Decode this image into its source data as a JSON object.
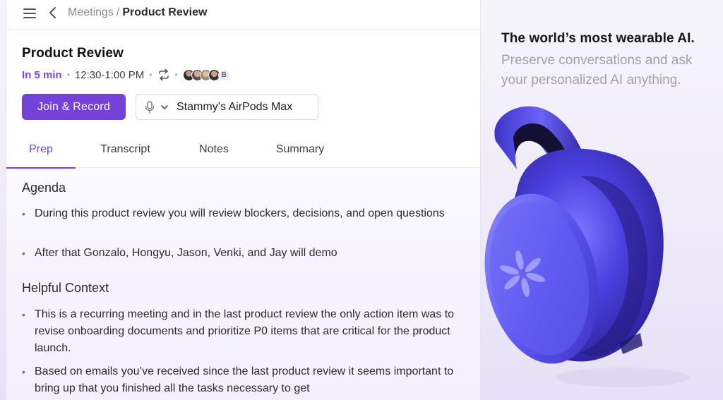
{
  "breadcrumb": {
    "parent": "Meetings",
    "separator": "/",
    "current": "Product Review"
  },
  "meeting": {
    "title": "Product Review",
    "starts_in": "In 5 min",
    "time": "12:30-1:00 PM",
    "attendee_overflow_letter": "B"
  },
  "actions": {
    "join_label": "Join & Record",
    "device_label": "Stammy’s AirPods Max"
  },
  "tabs": [
    {
      "label": "Prep",
      "active": true
    },
    {
      "label": "Transcript",
      "active": false
    },
    {
      "label": "Notes",
      "active": false
    },
    {
      "label": "Summary",
      "active": false
    }
  ],
  "agenda": {
    "title": "Agenda",
    "items": [
      "During this product review you will review blockers, decisions, and open questions",
      "After that Gonzalo, Hongyu, Jason, Venki, and Jay will demo"
    ]
  },
  "context": {
    "title": "Helpful Context",
    "items": [
      "This is a recurring meeting and in the last product review the only action item was to revise onboarding documents and prioritize P0 items that are critical for the product launch.",
      "Based on emails you’ve received since the last product review it seems important to bring up that you finished all the tasks necessary to get"
    ]
  },
  "promo": {
    "title": "The world’s most wearable AI.",
    "subtitle": "Preserve conversations and ask your personalized AI anything."
  },
  "icons": {
    "menu": "menu-icon",
    "back": "chevron-left-icon",
    "repeat": "repeat-icon",
    "mic": "microphone-icon",
    "dropdown": "chevron-down-icon"
  },
  "colors": {
    "accent": "#7442d8",
    "starts_in": "#7a47db",
    "device": "#4a3fd6"
  }
}
